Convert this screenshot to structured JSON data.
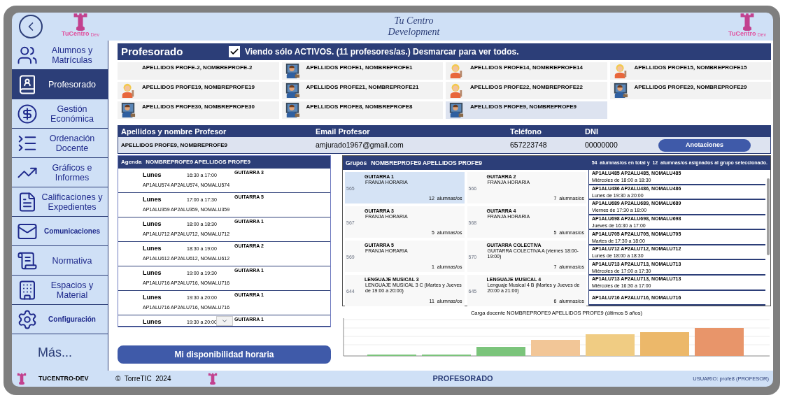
{
  "header": {
    "title_line1": "Tu Centro",
    "title_line2": "Development",
    "logo_left": {
      "name": "TuCentro",
      "sub": "Dev"
    },
    "logo_right": {
      "name": "TuCentro",
      "sub": "Dev"
    }
  },
  "sidebar": {
    "items": [
      {
        "label": "Alumnos y Matrículas",
        "selected": false
      },
      {
        "label": "Profesorado",
        "selected": true
      },
      {
        "label": "Gestión Económica",
        "selected": false
      },
      {
        "label": "Ordenación Docente",
        "selected": false
      },
      {
        "label": "Gráficos e Informes",
        "selected": false
      },
      {
        "label": "Calificaciones y Expedientes",
        "selected": false
      },
      {
        "label": "Comunicaciones",
        "selected": false
      },
      {
        "label": "Normativa",
        "selected": false
      },
      {
        "label": "Espacios y Material",
        "selected": false
      },
      {
        "label": "Configuración",
        "selected": false
      }
    ],
    "more": "Más..."
  },
  "section": {
    "title": "Profesorado",
    "filter_checked": true,
    "filter_label": "Viendo sólo ACTIVOS. (11 profesores/as.) Desmarcar para ver todos."
  },
  "teachers": [
    {
      "name": "APELLIDOS PROFE-2, NOMBREPROFE-2",
      "kind": "none",
      "selected": false
    },
    {
      "name": "APELLIDOS PROFE1, NOMBREPROFE1",
      "kind": "male",
      "selected": false
    },
    {
      "name": "APELLIDOS PROFE14, NOMBREPROFE14",
      "kind": "female",
      "selected": false
    },
    {
      "name": "APELLIDOS PROFE15, NOMBREPROFE15",
      "kind": "female",
      "selected": false
    },
    {
      "name": "APELLIDOS PROFE19, NOMBREPROFE19",
      "kind": "female",
      "selected": false
    },
    {
      "name": "APELLIDOS PROFE21, NOMBREPROFE21",
      "kind": "male",
      "selected": false
    },
    {
      "name": "APELLIDOS PROFE22, NOMBREPROFE22",
      "kind": "female",
      "selected": false
    },
    {
      "name": "APELLIDOS PROFE29, NOMBREPROFE29",
      "kind": "male",
      "selected": false
    },
    {
      "name": "APELLIDOS PROFE30, NOMBREPROFE30",
      "kind": "male",
      "selected": false
    },
    {
      "name": "APELLIDOS PROFE8, NOMBREPROFE8",
      "kind": "male",
      "selected": false
    },
    {
      "name": "APELLIDOS PROFE9, NOMBREPROFE9",
      "kind": "male",
      "selected": true
    }
  ],
  "detail": {
    "columns": [
      "Apellidos y nombre Profesor",
      "Email Profesor",
      "Teléfono",
      "DNI"
    ],
    "row": [
      "APELLIDOS PROFE9, NOMBREPROFE9",
      "amjurado1967@gmail.com",
      "657223748",
      "00000000"
    ],
    "button": "Anotaciones"
  },
  "agenda": {
    "label": "Agenda",
    "teacher": "NOMBREPROFE9 APELLIDOS PROFE9",
    "rows": [
      {
        "day": "Lunes",
        "time": "16:30 a 17:00",
        "subject": "GUITARRA 3",
        "student": "AP1ALU574 AP2ALU574, NOMALU574"
      },
      {
        "day": "Lunes",
        "time": "17:00 a 17:30",
        "subject": "GUITARRA 5",
        "student": "AP1ALU359 AP2ALU359, NOMALU359"
      },
      {
        "day": "Lunes",
        "time": "18:00 a 18:30",
        "subject": "GUITARRA 1",
        "student": "AP1ALU712 AP2ALU712, NOMALU712"
      },
      {
        "day": "Lunes",
        "time": "18:30 a 19:00",
        "subject": "GUITARRA 2",
        "student": "AP1ALU612 AP2ALU612, NOMALU612"
      },
      {
        "day": "Lunes",
        "time": "19:00 a 19:30",
        "subject": "GUITARRA 1",
        "student": "AP1ALU716 AP2ALU716, NOMALU716"
      },
      {
        "day": "Lunes",
        "time": "19:30 a 20:00",
        "subject": "GUITARRA 1",
        "student": "AP1ALU716 AP2ALU716, NOMALU716"
      },
      {
        "day": "Lunes",
        "time": "19:30 a 20:00",
        "subject": "GUITARRA 1"
      }
    ]
  },
  "groups": {
    "label": "Grupos",
    "teacher": "NOMBREPROFE9 APELLIDOS PROFE9",
    "summary": "54  alumnas/os en total y  12  alumnas/os asignados al grupo seleccionado.",
    "cards": [
      {
        "id": "565",
        "name": "GUITARRA 1",
        "schedule": "FRANJA HORARIA",
        "count": "12  alumnas/os",
        "selected": true
      },
      {
        "id": "566",
        "name": "GUITARRA 2",
        "schedule": "FRANJA HORARIA",
        "count": "7  alumnas/os",
        "selected": false
      },
      {
        "id": "567",
        "name": "GUITARRA 3",
        "schedule": "FRANJA HORARIA",
        "count": "5  alumnas/os",
        "selected": false
      },
      {
        "id": "568",
        "name": "GUITARRA 4",
        "schedule": "FRANJA HORARIA",
        "count": "5  alumnas/os",
        "selected": false
      },
      {
        "id": "569",
        "name": "GUITARRA 5",
        "schedule": "FRANJA HORARIA",
        "count": "1  alumnas/os",
        "selected": false
      },
      {
        "id": "570",
        "name": "GUITARRA COLECTIVA",
        "schedule": "GUITARRA COLECTIVA A (viernes 18:00-19:00)",
        "count": "7  alumnas/os",
        "selected": false
      },
      {
        "id": "644",
        "name": "LENGUAJE MUSICAL 3",
        "schedule": "LENGUAJE MUSICAL 3 C (Martes y Jueves de 19:00 a 20:00)",
        "count": "11  alumnas/os",
        "selected": false
      },
      {
        "id": "645",
        "name": "LENGUAJE MUSICAL 4",
        "schedule": "Lenguaje Musical 4 B (Martes y Jueves de 20:00 a 21:00)",
        "count": "6  alumnas/os",
        "selected": false
      }
    ],
    "students": [
      {
        "name": "AP1ALU485 AP2ALU485, NOMALU485",
        "schedule": "Miércoles de 18:00 a 18:30"
      },
      {
        "name": "AP1ALU486 AP2ALU486, NOMALU486",
        "schedule": "Lunes de 19:30 a 20:00"
      },
      {
        "name": "AP1ALU689 AP2ALU689, NOMALU689",
        "schedule": "Viernes de 17:30 a 18:00"
      },
      {
        "name": "AP1ALU698 AP2ALU698, NOMALU698",
        "schedule": "Jueves de 16:30 a 17:00"
      },
      {
        "name": "AP1ALU705 AP2ALU705, NOMALU705",
        "schedule": "Martes de 17:30 a 18:00"
      },
      {
        "name": "AP1ALU712 AP2ALU712, NOMALU712",
        "schedule": "Lunes de 18:00 a 18:30"
      },
      {
        "name": "AP1ALU713 AP2ALU713, NOMALU713",
        "schedule": "Miércoles de 17:00 a 17:30"
      },
      {
        "name": "AP1ALU713 AP2ALU713, NOMALU713",
        "schedule": "Miércoles de 16:30 a 17:00"
      },
      {
        "name": "AP1ALU716 AP2ALU716, NOMALU716"
      }
    ]
  },
  "chart": {
    "title": "Carga docente   NOMBREPROFE9 APELLIDOS PROFE9 (últimos 5 años)"
  },
  "availability_button": "Mi disponibilidad horaria",
  "footer": {
    "app": "TUCENTRO-DEV",
    "copyright": "©  TorreTIC  2024",
    "section": "PROFESORADO",
    "user": "USUARIO: profe8 (PROFESOR)"
  }
}
